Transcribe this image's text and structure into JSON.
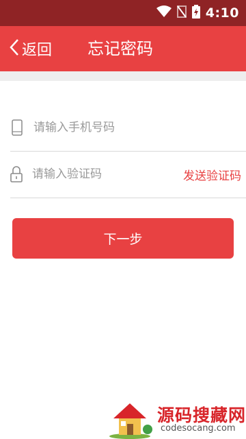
{
  "status_bar": {
    "time": "4:10"
  },
  "header": {
    "back_label": "返回",
    "title": "忘记密码"
  },
  "form": {
    "phone_placeholder": "请输入手机号码",
    "code_placeholder": "请输入验证码",
    "send_code_label": "发送验证码",
    "next_label": "下一步"
  },
  "watermark": {
    "name": "源码搜藏网",
    "url": "codesocang.com"
  },
  "colors": {
    "accent": "#e84142",
    "status_bar": "#8f2325"
  }
}
